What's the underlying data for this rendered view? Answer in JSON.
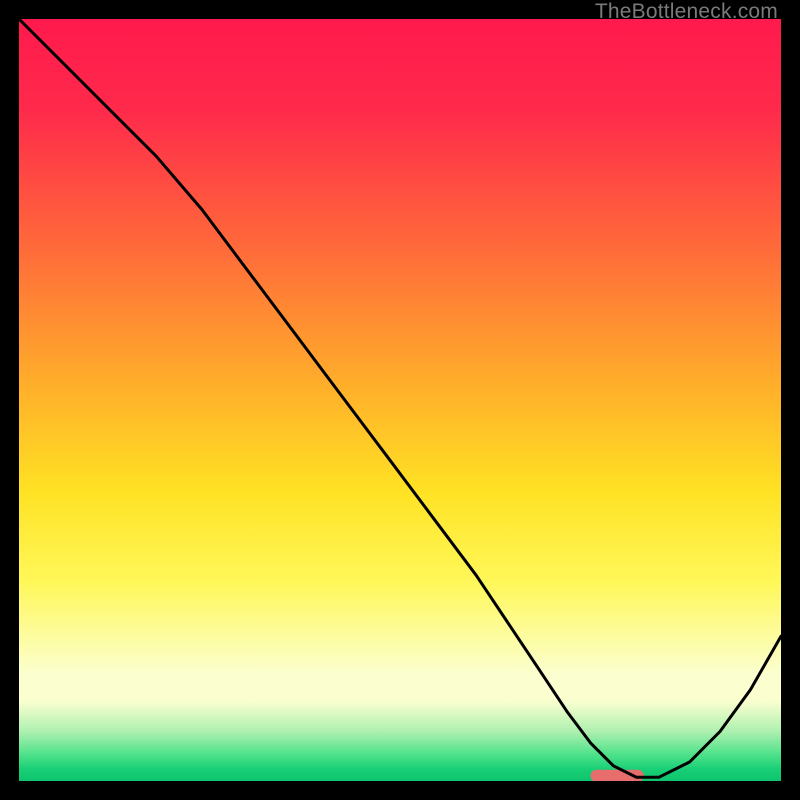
{
  "watermark": "TheBottleneck.com",
  "colors": {
    "frame": "#000000",
    "gradient_stops": [
      {
        "pos": 0.0,
        "color": "#ff1a4d"
      },
      {
        "pos": 0.12,
        "color": "#ff2a4b"
      },
      {
        "pos": 0.3,
        "color": "#ff6a3a"
      },
      {
        "pos": 0.48,
        "color": "#ffae2a"
      },
      {
        "pos": 0.62,
        "color": "#ffe224"
      },
      {
        "pos": 0.74,
        "color": "#fff85a"
      },
      {
        "pos": 0.86,
        "color": "#fbffd0"
      },
      {
        "pos": 0.895,
        "color": "#fbffd0"
      },
      {
        "pos": 0.935,
        "color": "#aef0b0"
      },
      {
        "pos": 0.965,
        "color": "#4fe28a"
      },
      {
        "pos": 0.985,
        "color": "#17cf76"
      },
      {
        "pos": 1.0,
        "color": "#0fc46e"
      }
    ],
    "curve": "#000000",
    "marker": "#e86d6d"
  },
  "chart_data": {
    "type": "line",
    "title": "",
    "xlabel": "",
    "ylabel": "",
    "xlim": [
      0,
      100
    ],
    "ylim": [
      0,
      100
    ],
    "grid": false,
    "legend": false,
    "series": [
      {
        "name": "bottleneck-curve",
        "x": [
          0,
          6,
          12,
          18,
          24,
          30,
          36,
          42,
          48,
          54,
          60,
          64,
          68,
          72,
          75,
          78,
          81,
          84,
          88,
          92,
          96,
          100
        ],
        "y": [
          100,
          94,
          88,
          82,
          75,
          67,
          59,
          51,
          43,
          35,
          27,
          21,
          15,
          9,
          5,
          2,
          0.5,
          0.5,
          2.5,
          6.5,
          12,
          19
        ]
      }
    ],
    "marker": {
      "x_range": [
        75,
        82
      ],
      "y": 0.7
    }
  }
}
